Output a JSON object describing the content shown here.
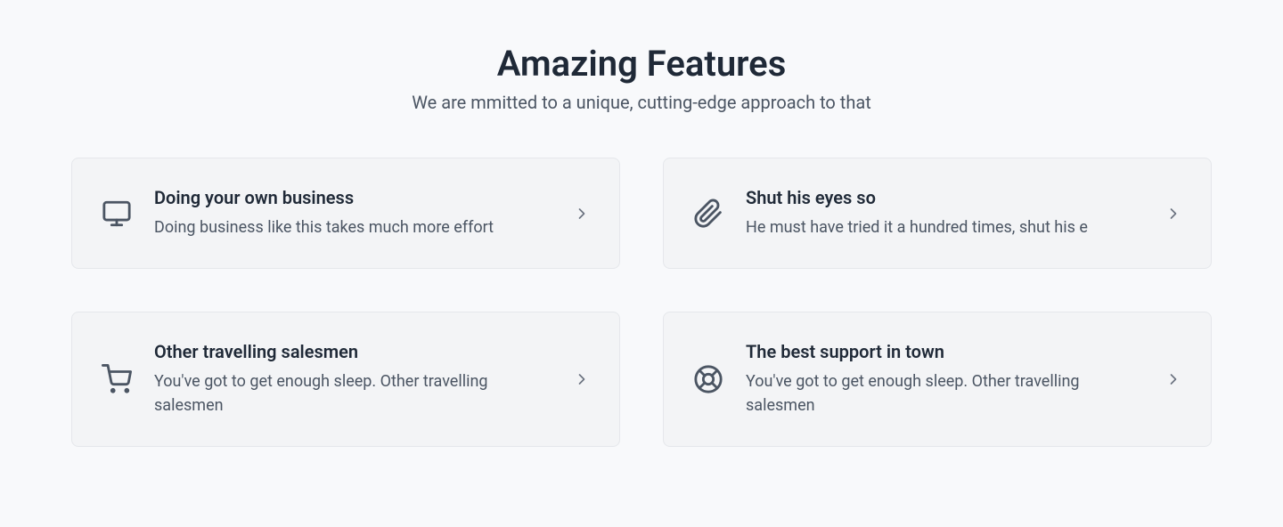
{
  "header": {
    "title": "Amazing Features",
    "subtitle": "We are mmitted to a unique, cutting-edge approach to that"
  },
  "features": [
    {
      "title": "Doing your own business",
      "description": "Doing business like this takes much more effort",
      "icon": "desktop"
    },
    {
      "title": "Shut his eyes so",
      "description": "He must have tried it a hundred times, shut his e",
      "icon": "paperclip"
    },
    {
      "title": "Other travelling salesmen",
      "description": "You've got to get enough sleep. Other travelling salesmen",
      "icon": "shopping-cart"
    },
    {
      "title": "The best support in town",
      "description": "You've got to get enough sleep. Other travelling salesmen",
      "icon": "lifebuoy"
    }
  ]
}
